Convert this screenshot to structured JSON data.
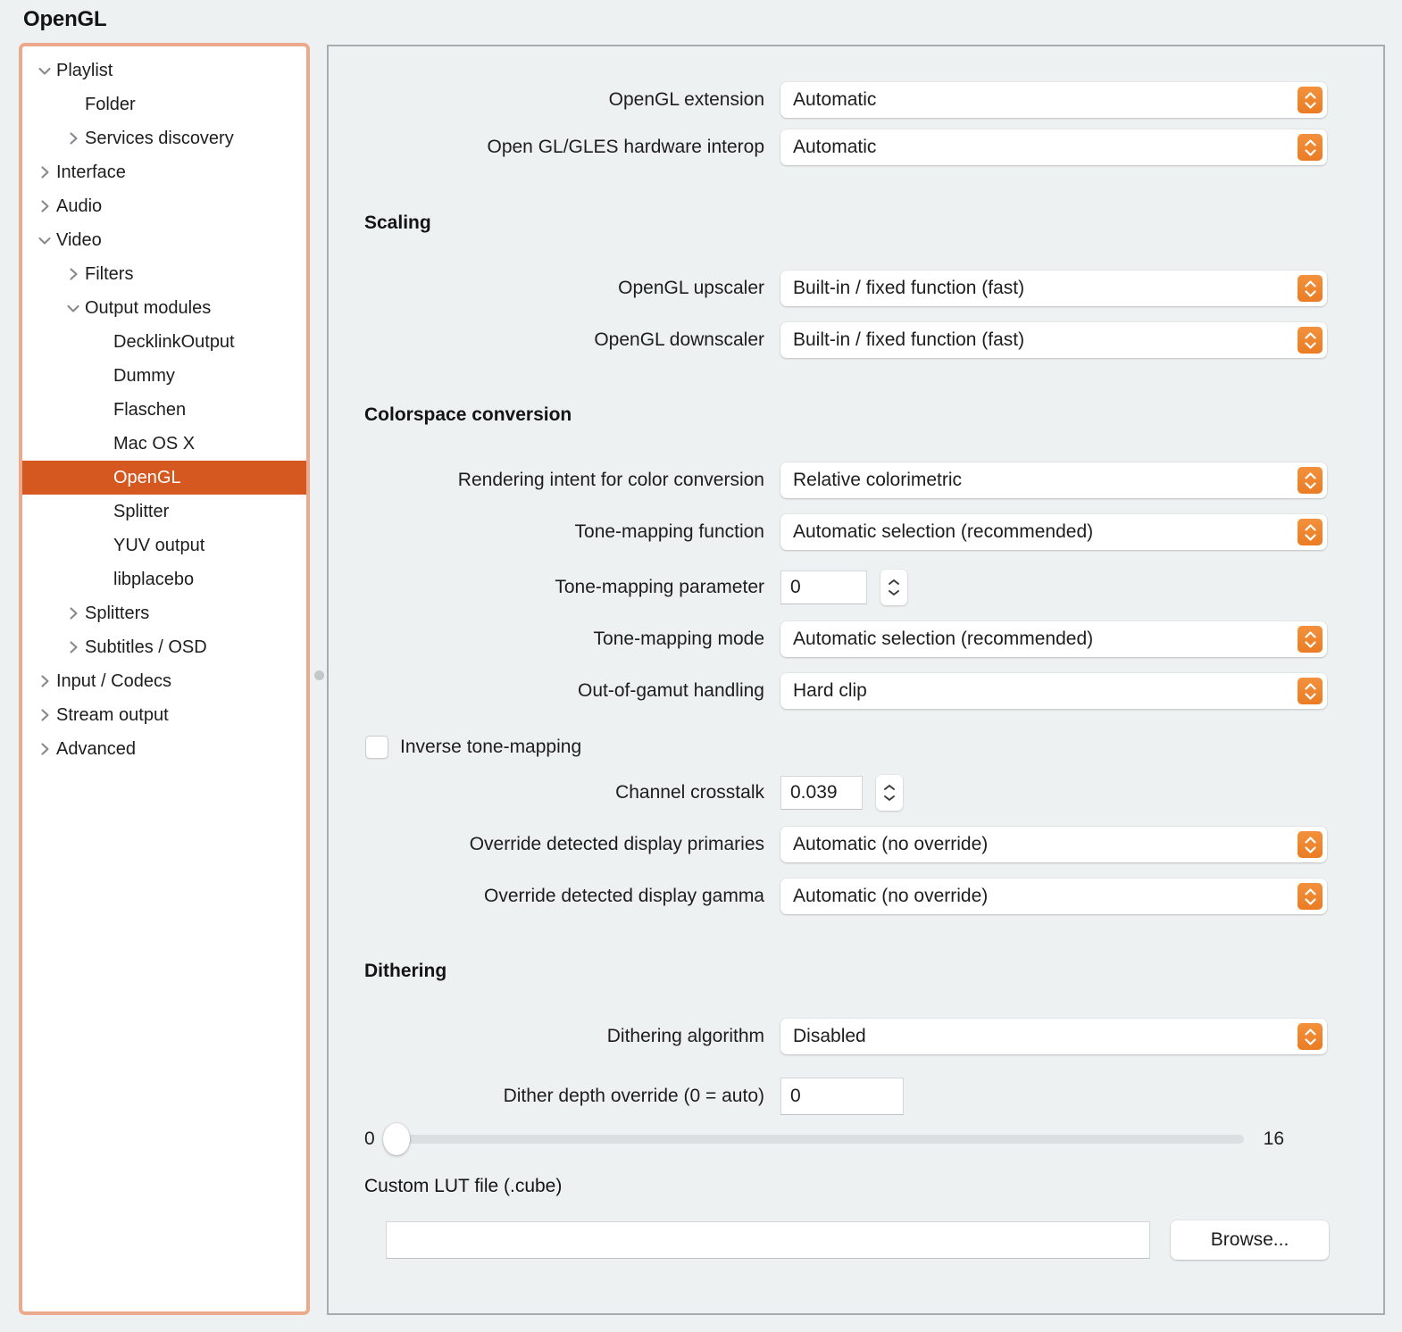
{
  "page": {
    "title": "OpenGL",
    "accent_orange": "#ea7c24",
    "selection_orange": "#d4581f",
    "focus_ring_color": "#eda98c",
    "panel_background": "#eef1f2"
  },
  "sidebar": {
    "items": [
      {
        "label": "Playlist",
        "level": 0,
        "chevron": "chevron-down-icon",
        "selected": false
      },
      {
        "label": "Folder",
        "level": 1,
        "chevron": "none",
        "selected": false
      },
      {
        "label": "Services discovery",
        "level": 1,
        "chevron": "chevron-right-icon",
        "selected": false
      },
      {
        "label": "Interface",
        "level": 0,
        "chevron": "chevron-right-icon",
        "selected": false
      },
      {
        "label": "Audio",
        "level": 0,
        "chevron": "chevron-right-icon",
        "selected": false
      },
      {
        "label": "Video",
        "level": 0,
        "chevron": "chevron-down-icon",
        "selected": false
      },
      {
        "label": "Filters",
        "level": 1,
        "chevron": "chevron-right-icon",
        "selected": false
      },
      {
        "label": "Output modules",
        "level": 1,
        "chevron": "chevron-down-icon",
        "selected": false
      },
      {
        "label": "DecklinkOutput",
        "level": 2,
        "chevron": "none",
        "selected": false
      },
      {
        "label": "Dummy",
        "level": 2,
        "chevron": "none",
        "selected": false
      },
      {
        "label": "Flaschen",
        "level": 2,
        "chevron": "none",
        "selected": false
      },
      {
        "label": "Mac OS X",
        "level": 2,
        "chevron": "none",
        "selected": false
      },
      {
        "label": "OpenGL",
        "level": 2,
        "chevron": "none",
        "selected": true
      },
      {
        "label": "Splitter",
        "level": 2,
        "chevron": "none",
        "selected": false
      },
      {
        "label": "YUV output",
        "level": 2,
        "chevron": "none",
        "selected": false
      },
      {
        "label": "libplacebo",
        "level": 2,
        "chevron": "none",
        "selected": false
      },
      {
        "label": "Splitters",
        "level": 1,
        "chevron": "chevron-right-icon",
        "selected": false
      },
      {
        "label": "Subtitles / OSD",
        "level": 1,
        "chevron": "chevron-right-icon",
        "selected": false
      },
      {
        "label": "Input / Codecs",
        "level": 0,
        "chevron": "chevron-right-icon",
        "selected": false
      },
      {
        "label": "Stream output",
        "level": 0,
        "chevron": "chevron-right-icon",
        "selected": false
      },
      {
        "label": "Advanced",
        "level": 0,
        "chevron": "chevron-right-icon",
        "selected": false
      }
    ]
  },
  "settings": {
    "opengl_extension": {
      "label": "OpenGL extension",
      "value": "Automatic"
    },
    "hardware_interop": {
      "label": "Open GL/GLES hardware interop",
      "value": "Automatic"
    },
    "scaling_section": "Scaling",
    "opengl_upscaler": {
      "label": "OpenGL upscaler",
      "value": "Built-in / fixed function (fast)"
    },
    "opengl_downscaler": {
      "label": "OpenGL downscaler",
      "value": "Built-in / fixed function (fast)"
    },
    "colorspace_section": "Colorspace conversion",
    "rendering_intent": {
      "label": "Rendering intent for color conversion",
      "value": "Relative colorimetric"
    },
    "tone_mapping_function": {
      "label": "Tone-mapping function",
      "value": "Automatic selection (recommended)"
    },
    "tone_mapping_parameter": {
      "label": "Tone-mapping parameter",
      "value": "0"
    },
    "tone_mapping_mode": {
      "label": "Tone-mapping mode",
      "value": "Automatic selection (recommended)"
    },
    "out_of_gamut": {
      "label": "Out-of-gamut handling",
      "value": "Hard clip"
    },
    "inverse_tone_mapping": {
      "label": "Inverse tone-mapping",
      "checked": false
    },
    "channel_crosstalk": {
      "label": "Channel crosstalk",
      "value": "0.039"
    },
    "override_primaries": {
      "label": "Override detected display primaries",
      "value": "Automatic (no override)"
    },
    "override_gamma": {
      "label": "Override detected display gamma",
      "value": "Automatic (no override)"
    },
    "dithering_section": "Dithering",
    "dithering_algorithm": {
      "label": "Dithering algorithm",
      "value": "Disabled"
    },
    "dither_depth": {
      "label": "Dither depth override (0 = auto)",
      "value": "0"
    },
    "dither_slider": {
      "min_label": "0",
      "max_label": "16",
      "value": 0,
      "min": 0,
      "max": 16
    },
    "custom_lut": {
      "label": "Custom LUT file (.cube)",
      "value": "",
      "browse_label": "Browse..."
    }
  }
}
